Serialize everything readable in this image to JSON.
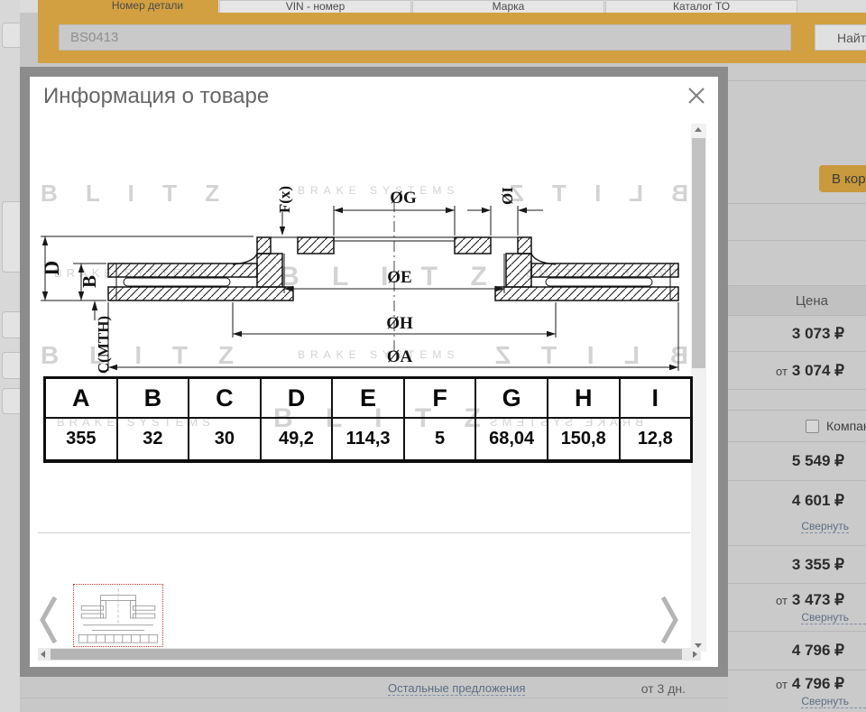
{
  "page": {
    "tabs": [
      {
        "label": "Номер детали"
      },
      {
        "label": "VIN - номер"
      },
      {
        "label": "Марка"
      },
      {
        "label": "Каталог ТО"
      }
    ],
    "search": {
      "value": "BS0413",
      "button": "Найти"
    },
    "results": {
      "price_header": "Цена",
      "cart_button": "В корзину",
      "company_label": "Компания",
      "collapse": "Свернуть",
      "rows": [
        {
          "prefix": "",
          "price": "3 073 ₽"
        },
        {
          "prefix": "от",
          "price": "3 074 ₽"
        },
        {
          "prefix": "",
          "price": "5 549 ₽"
        },
        {
          "prefix": "",
          "price": "4 601 ₽"
        },
        {
          "prefix": "",
          "price": "3 355 ₽"
        },
        {
          "prefix": "от",
          "price": "3 473 ₽"
        },
        {
          "prefix": "",
          "price": "4 796 ₽"
        },
        {
          "prefix": "от",
          "price": "4 796 ₽"
        }
      ],
      "other_offers": "Остальные предложения",
      "delivery": "от 3 дн."
    }
  },
  "modal": {
    "title": "Информация о товаре",
    "watermark": {
      "brand": "B L I T Z",
      "sub": "BRAKE SYSTEMS"
    },
    "drawing_labels": {
      "D": "D",
      "B": "B",
      "C": "C(MTH)",
      "F": "F(x)",
      "G": "ØG",
      "I": "ØI",
      "E": "ØE",
      "H": "ØH",
      "A": "ØA"
    },
    "spec_table": {
      "headers": [
        "A",
        "B",
        "C",
        "D",
        "E",
        "F",
        "G",
        "H",
        "I"
      ],
      "values": [
        "355",
        "32",
        "30",
        "49,2",
        "114,3",
        "5",
        "68,04",
        "150,8",
        "12,8"
      ]
    }
  },
  "colors": {
    "accent": "#d2a041",
    "overlay": "#c6c6c6",
    "link": "#5d6d82"
  }
}
